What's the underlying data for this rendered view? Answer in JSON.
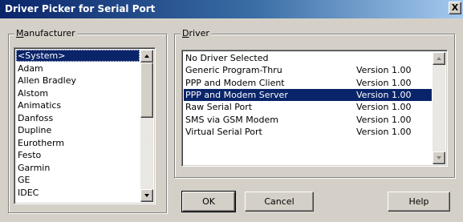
{
  "window": {
    "title": "Driver Picker for Serial Port",
    "close_glyph": "X"
  },
  "manufacturer": {
    "label_mnemonic": "M",
    "label_rest": "anufacturer",
    "items": [
      "<System>",
      "Adam",
      "Allen Bradley",
      "Alstom",
      "Animatics",
      "Danfoss",
      "Dupline",
      "Eurotherm",
      "Festo",
      "Garmin",
      "GE",
      "IDEC"
    ],
    "selected_index": 0
  },
  "driver": {
    "label_mnemonic": "D",
    "label_rest": "river",
    "items": [
      {
        "name": "No Driver Selected",
        "version": ""
      },
      {
        "name": "Generic Program-Thru",
        "version": "Version 1.00"
      },
      {
        "name": "PPP and Modem Client",
        "version": "Version 1.00"
      },
      {
        "name": "PPP and Modem Server",
        "version": "Version 1.00"
      },
      {
        "name": "Raw Serial Port",
        "version": "Version 1.00"
      },
      {
        "name": "SMS via GSM Modem",
        "version": "Version 1.00"
      },
      {
        "name": "Virtual Serial Port",
        "version": "Version 1.00"
      }
    ],
    "selected_index": 3
  },
  "buttons": {
    "ok": "OK",
    "cancel": "Cancel",
    "help": "Help"
  },
  "colors": {
    "face": "#d4d0c8",
    "selection": "#0a246a",
    "title_start": "#0a246a",
    "title_end": "#a6caf0"
  }
}
